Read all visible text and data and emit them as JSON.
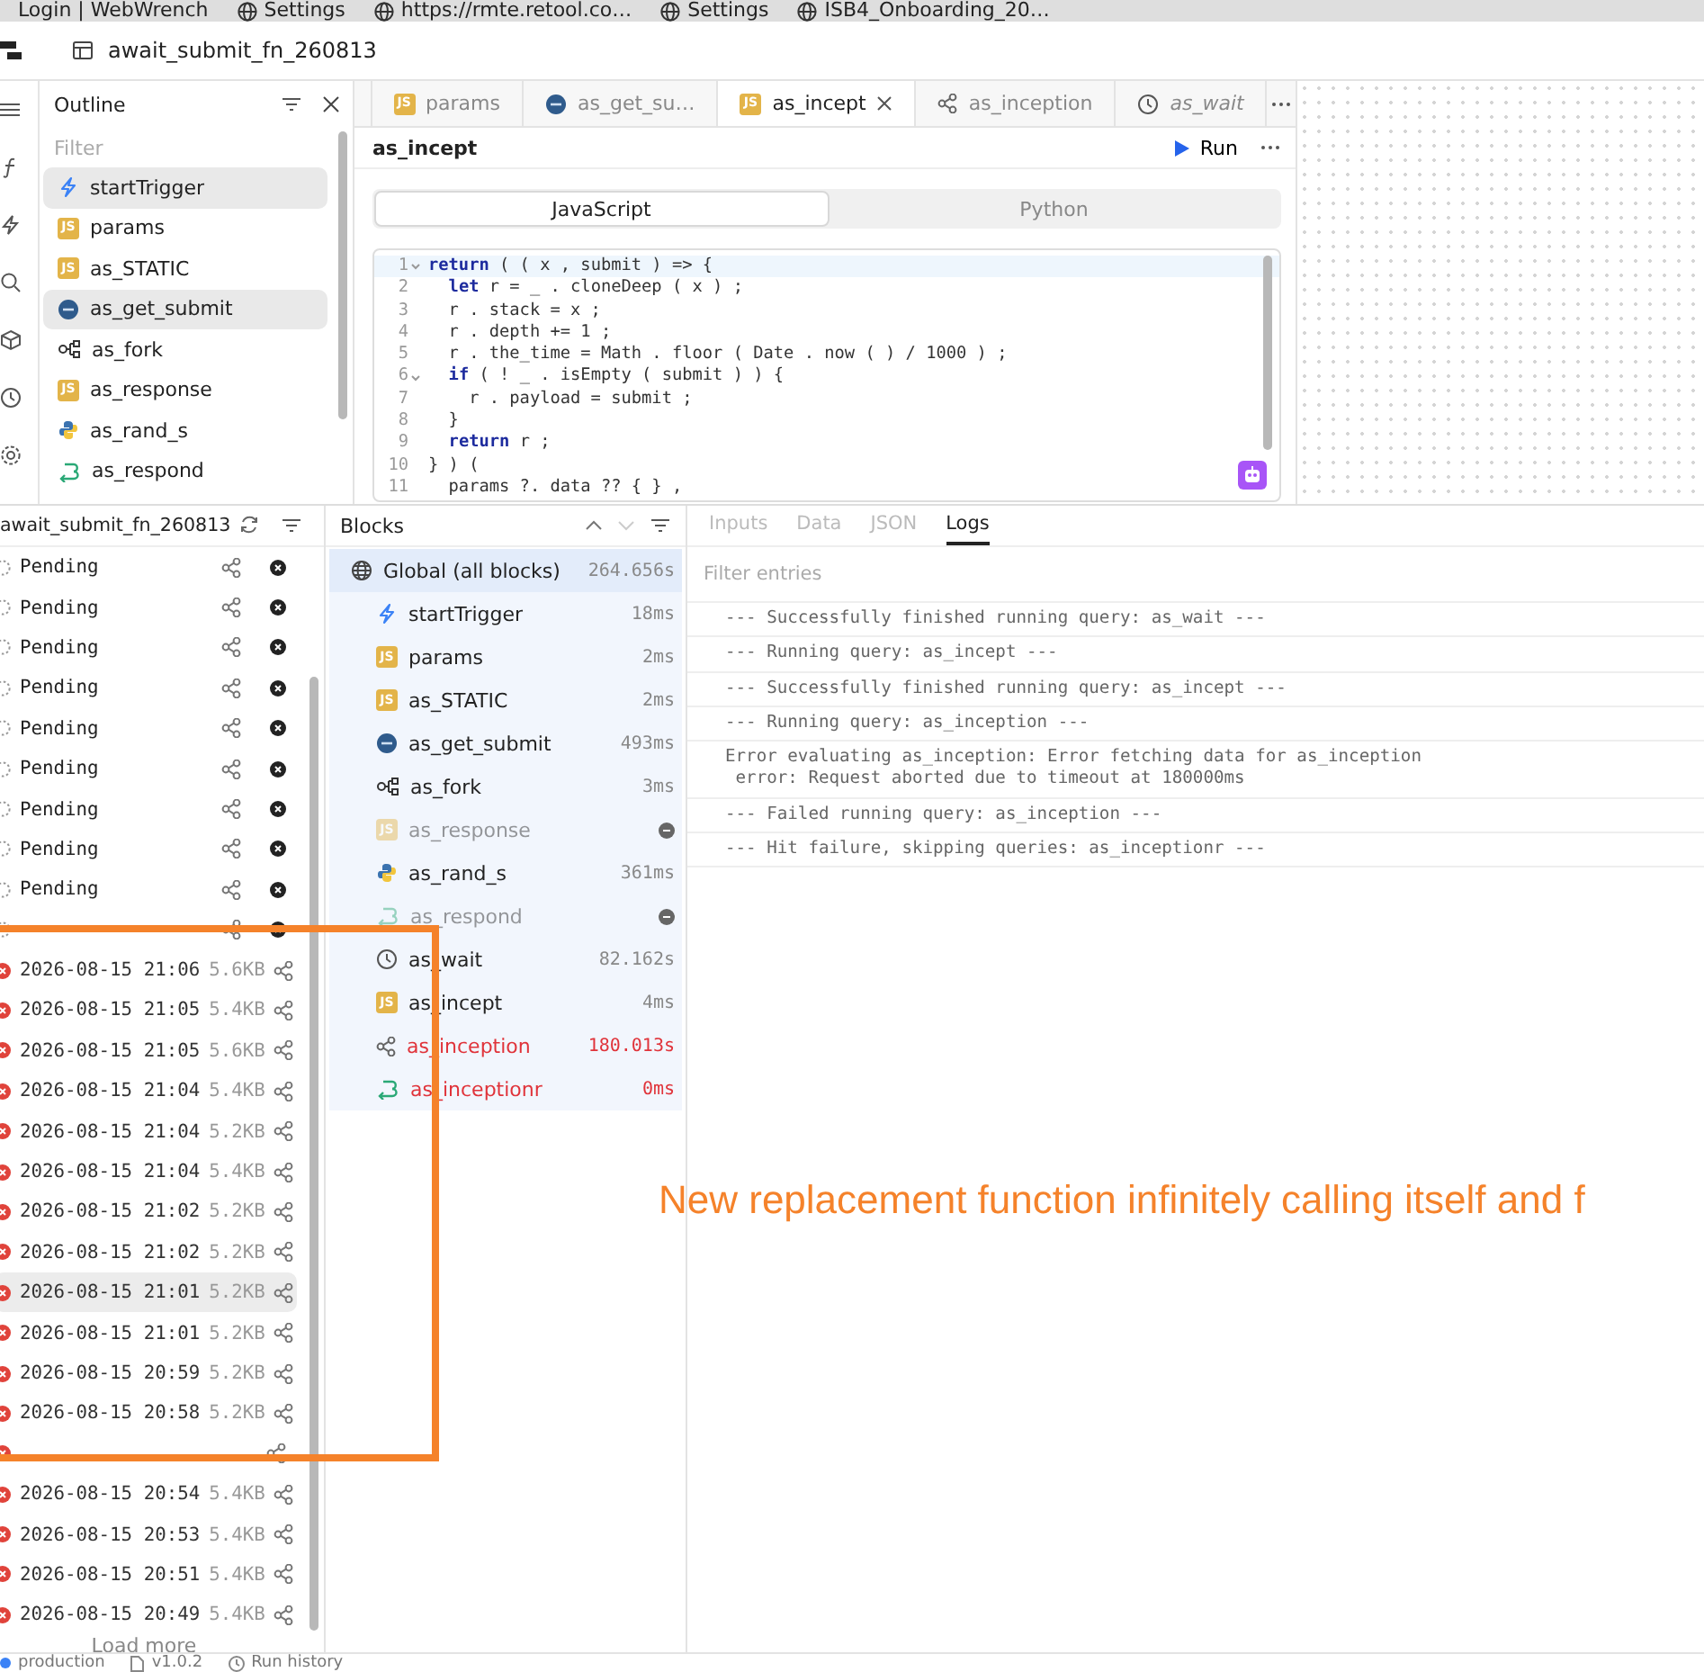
{
  "browser_tabs": [
    {
      "label": "Login | WebWrench",
      "globe": false
    },
    {
      "label": "Settings",
      "globe": true
    },
    {
      "label": "https://rmte.retool.co…",
      "globe": true
    },
    {
      "label": "Settings",
      "globe": true
    },
    {
      "label": "ISB4_Onboarding_20…",
      "globe": true
    }
  ],
  "app": {
    "title": "await_submit_fn_260813"
  },
  "outline": {
    "title": "Outline",
    "filter": {
      "placeholder": "Filter"
    },
    "items": [
      {
        "kind": "trigger",
        "name": "startTrigger",
        "selected": true
      },
      {
        "kind": "js",
        "badge": "JS",
        "name": "params",
        "selected": false
      },
      {
        "kind": "js",
        "badge": "JS",
        "name": "as_STATIC",
        "selected": false
      },
      {
        "kind": "sql",
        "name": "as_get_submit",
        "selected": true
      },
      {
        "kind": "fork",
        "name": "as_fork",
        "selected": false
      },
      {
        "kind": "js",
        "badge": "JS",
        "name": "as_response",
        "selected": false
      },
      {
        "kind": "python",
        "name": "as_rand_s",
        "selected": false
      },
      {
        "kind": "respond",
        "name": "as_respond",
        "selected": false
      }
    ]
  },
  "editor": {
    "tabs": [
      {
        "kind": "js",
        "badge": "JS",
        "label": "params",
        "selected": false,
        "preview": false
      },
      {
        "kind": "sql",
        "label": "as_get_su…",
        "selected": false,
        "preview": false
      },
      {
        "kind": "js",
        "badge": "JS",
        "label": "as_incept",
        "selected": true,
        "preview": false
      },
      {
        "kind": "share",
        "label": "as_inception",
        "selected": false,
        "preview": false
      },
      {
        "kind": "wait",
        "label": "as_wait",
        "selected": false,
        "preview": true
      }
    ],
    "query_name": "as_incept",
    "run_label": "Run",
    "languages": [
      {
        "label": "JavaScript",
        "selected": true
      },
      {
        "label": "Python",
        "selected": false
      }
    ],
    "code": [
      {
        "number": "1",
        "fold": true,
        "current": true,
        "text": "**return** ( ( x , submit ) => {"
      },
      {
        "number": "2",
        "fold": false,
        "current": false,
        "text": "  **let** r = _ . cloneDeep ( x ) ;"
      },
      {
        "number": "3",
        "fold": false,
        "current": false,
        "text": "  r . stack = x ;"
      },
      {
        "number": "4",
        "fold": false,
        "current": false,
        "text": "  r . depth += 1 ;"
      },
      {
        "number": "5",
        "fold": false,
        "current": false,
        "text": "  r . the_time = Math . floor ( Date . now ( ) / 1000 ) ;"
      },
      {
        "number": "6",
        "fold": true,
        "current": false,
        "text": "  **if** ( ! _ . isEmpty ( submit ) ) {"
      },
      {
        "number": "7",
        "fold": false,
        "current": false,
        "text": "    r . payload = submit ;"
      },
      {
        "number": "8",
        "fold": false,
        "current": false,
        "text": "  }"
      },
      {
        "number": "9",
        "fold": false,
        "current": false,
        "text": "  **return** r ;"
      },
      {
        "number": "10",
        "fold": false,
        "current": false,
        "text": "} ) ("
      },
      {
        "number": "11",
        "fold": false,
        "current": false,
        "text": "  params ?. data ?? { } ,"
      }
    ]
  },
  "runs": {
    "title": "await_submit_fn_260813",
    "rows": [
      {
        "kind": "pending",
        "label": "Pending",
        "selected": false
      },
      {
        "kind": "pending",
        "label": "Pending",
        "selected": false
      },
      {
        "kind": "pending",
        "label": "Pending",
        "selected": false
      },
      {
        "kind": "pending",
        "label": "Pending",
        "selected": false
      },
      {
        "kind": "pending",
        "label": "Pending",
        "selected": false
      },
      {
        "kind": "pending",
        "label": "Pending",
        "selected": false
      },
      {
        "kind": "pending",
        "label": "Pending",
        "selected": false
      },
      {
        "kind": "pending",
        "label": "Pending",
        "selected": false
      },
      {
        "kind": "pending",
        "label": "Pending",
        "selected": false
      },
      {
        "kind": "pending",
        "selected": false
      },
      {
        "kind": "failed",
        "date": "2026-08-15 21:06",
        "size": "5.6KB",
        "selected": false
      },
      {
        "kind": "failed",
        "date": "2026-08-15 21:05",
        "size": "5.4KB",
        "selected": false
      },
      {
        "kind": "failed",
        "date": "2026-08-15 21:05",
        "size": "5.6KB",
        "selected": false
      },
      {
        "kind": "failed",
        "date": "2026-08-15 21:04",
        "size": "5.4KB",
        "selected": false
      },
      {
        "kind": "failed",
        "date": "2026-08-15 21:04",
        "size": "5.2KB",
        "selected": false
      },
      {
        "kind": "failed",
        "date": "2026-08-15 21:04",
        "size": "5.4KB",
        "selected": false
      },
      {
        "kind": "failed",
        "date": "2026-08-15 21:02",
        "size": "5.2KB",
        "selected": false
      },
      {
        "kind": "failed",
        "date": "2026-08-15 21:02",
        "size": "5.2KB",
        "selected": false
      },
      {
        "kind": "failed",
        "date": "2026-08-15 21:01",
        "size": "5.2KB",
        "selected": true
      },
      {
        "kind": "failed",
        "date": "2026-08-15 21:01",
        "size": "5.2KB",
        "selected": false
      },
      {
        "kind": "failed",
        "date": "2026-08-15 20:59",
        "size": "5.2KB",
        "selected": false
      },
      {
        "kind": "failed",
        "date": "2026-08-15 20:58",
        "size": "5.2KB",
        "selected": false
      },
      {
        "kind": "failed",
        "selected": false
      },
      {
        "kind": "failed",
        "date": "2026-08-15 20:54",
        "size": "5.4KB",
        "selected": false
      },
      {
        "kind": "failed",
        "date": "2026-08-15 20:53",
        "size": "5.4KB",
        "selected": false
      },
      {
        "kind": "failed",
        "date": "2026-08-15 20:51",
        "size": "5.4KB",
        "selected": false
      },
      {
        "kind": "failed",
        "date": "2026-08-15 20:49",
        "size": "5.4KB",
        "selected": false
      }
    ],
    "load_more": "Load more"
  },
  "blocks": {
    "title": "Blocks",
    "items": [
      {
        "kind": "globe",
        "name": "Global (all blocks)",
        "time": "264.656s",
        "skipped": false,
        "failed": false,
        "selected": true,
        "children": [
          {
            "kind": "trigger",
            "name": "startTrigger",
            "time": "18ms",
            "skipped": false,
            "failed": false
          },
          {
            "kind": "js",
            "badge": "JS",
            "name": "params",
            "time": "2ms",
            "skipped": false,
            "failed": false
          },
          {
            "kind": "js",
            "badge": "JS",
            "name": "as_STATIC",
            "time": "2ms",
            "skipped": false,
            "failed": false
          },
          {
            "kind": "sql",
            "name": "as_get_submit",
            "time": "493ms",
            "skipped": false,
            "failed": false
          },
          {
            "kind": "fork",
            "name": "as_fork",
            "time": "3ms",
            "skipped": false,
            "failed": false
          },
          {
            "kind": "js",
            "badge": "JS",
            "name": "as_response",
            "skipped": true,
            "failed": false
          },
          {
            "kind": "python",
            "name": "as_rand_s",
            "time": "361ms",
            "skipped": false,
            "failed": false
          },
          {
            "kind": "respond",
            "name": "as_respond",
            "skipped": true,
            "failed": false
          },
          {
            "kind": "wait",
            "name": "as_wait",
            "time": "82.162s",
            "skipped": false,
            "failed": false
          },
          {
            "kind": "js",
            "badge": "JS",
            "name": "as_incept",
            "time": "4ms",
            "skipped": false,
            "failed": false
          },
          {
            "kind": "share",
            "name": "as_inception",
            "time": "180.013s",
            "skipped": false,
            "failed": true
          },
          {
            "kind": "respond",
            "name": "as_inceptionr",
            "time": "0ms",
            "skipped": false,
            "failed": true
          }
        ]
      }
    ]
  },
  "logs": {
    "tabs": [
      {
        "label": "Inputs",
        "selected": false
      },
      {
        "label": "Data",
        "selected": false
      },
      {
        "label": "JSON",
        "selected": false
      },
      {
        "label": "Logs",
        "selected": true
      }
    ],
    "filter": {
      "placeholder": "Filter entries"
    },
    "entries": [
      "--- Successfully finished running query: as_wait ---",
      "--- Running query: as_incept ---",
      "--- Successfully finished running query: as_incept ---",
      "--- Running query: as_inception ---",
      "Error evaluating as_inception: Error fetching data for as_inception\n error: Request aborted due to timeout at 180000ms",
      "--- Failed running query: as_inception ---",
      "--- Hit failure, skipping queries: as_inceptionr ---"
    ]
  },
  "status_bar": {
    "environment": "production",
    "version": "v1.0.2",
    "history": "Run history"
  },
  "annotation": {
    "text": "New replacement function infinitely calling itself and f"
  }
}
